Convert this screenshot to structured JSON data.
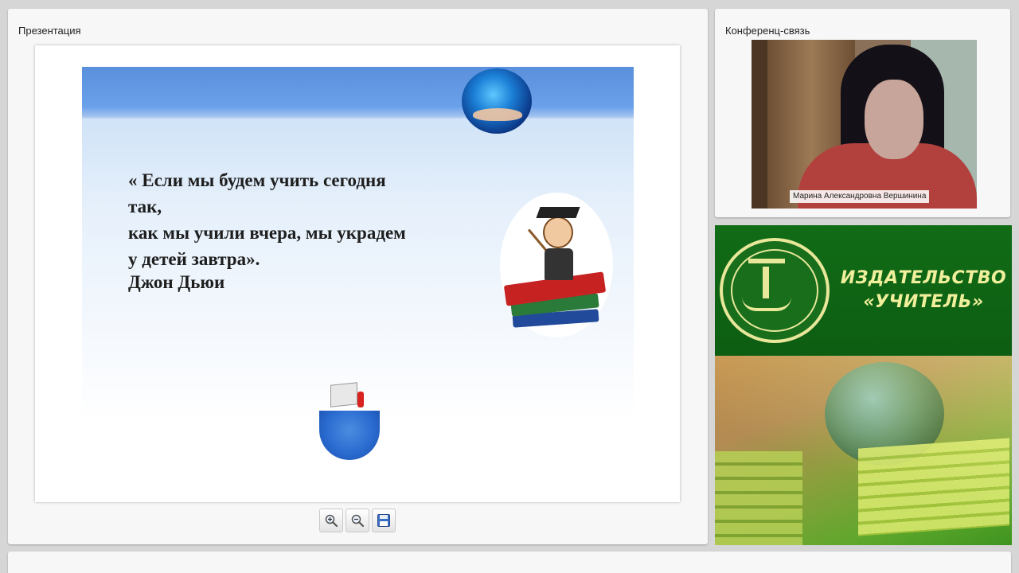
{
  "presentation": {
    "title": "Презентация",
    "slide": {
      "quote": "« Если мы будем учить сегодня\nтак,\n как мы учили вчера, мы украдем\nу детей завтра».",
      "author": "Джон Дьюи"
    },
    "toolbar": {
      "zoom_in_icon": "zoom-in-icon",
      "zoom_out_icon": "zoom-out-icon",
      "save_icon": "save-icon"
    }
  },
  "conference": {
    "title": "Конференц-связь",
    "participant_name": "Марина Александровна Вершинина"
  },
  "ad": {
    "line1": "ИЗДАТЕЛЬСТВО",
    "line2": "«УЧИТЕЛЬ»",
    "accent_color": "#f0ef9c",
    "background_color": "#0f6614"
  }
}
